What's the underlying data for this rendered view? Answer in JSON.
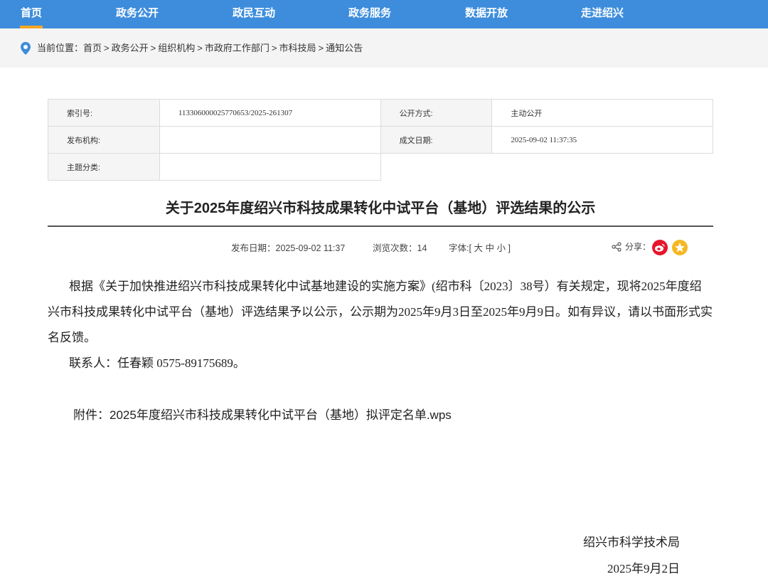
{
  "nav": {
    "items": [
      "首页",
      "政务公开",
      "政民互动",
      "政务服务",
      "数据开放",
      "走进绍兴"
    ],
    "active_index": 0,
    "bg_color": "#3d8ddc",
    "active_color": "#f5a623"
  },
  "breadcrumb": {
    "prefix": "当前位置：",
    "items": [
      "首页",
      "政务公开",
      "组织机构",
      "市政府工作部门",
      "市科技局",
      "通知公告"
    ],
    "separator": ">"
  },
  "meta": {
    "index_label": "索引号:",
    "index_value": "113306000025770653/2025-261307",
    "public_mode_label": "公开方式:",
    "public_mode_value": "主动公开",
    "publisher_label": "发布机构:",
    "publisher_value": "",
    "created_label": "成文日期:",
    "created_value": "2025-09-02 11:37:35",
    "topic_label": "主题分类:",
    "topic_value": ""
  },
  "article": {
    "title": "关于2025年度绍兴市科技成果转化中试平台（基地）评选结果的公示",
    "publish_date_label": "发布日期：",
    "publish_date": "2025-09-02 11:37",
    "views_label": "浏览次数：",
    "views": "14",
    "font_label": "字体:[",
    "font_large": "大",
    "font_medium": "中",
    "font_small": "小",
    "font_close": "]",
    "share_label": "分享：",
    "paragraph1": "根据《关于加快推进绍兴市科技成果转化中试基地建设的实施方案》(绍市科〔2023〕38号）有关规定，现将2025年度绍兴市科技成果转化中试平台（基地）评选结果予以公示，公示期为2025年9月3日至2025年9月9日。如有异议，请以书面形式实名反馈。",
    "paragraph2": "联系人：任春颖  0575-89175689。",
    "attachment_label": "附件：",
    "attachment_name": "2025年度绍兴市科技成果转化中试平台（基地）拟评定名单.wps",
    "sign_org": "绍兴市科学技术局",
    "sign_date": "2025年9月2日"
  },
  "icons": {
    "location": "location-pin-icon",
    "share": "share-icon",
    "weibo": "weibo-icon",
    "qzone": "qzone-icon"
  }
}
